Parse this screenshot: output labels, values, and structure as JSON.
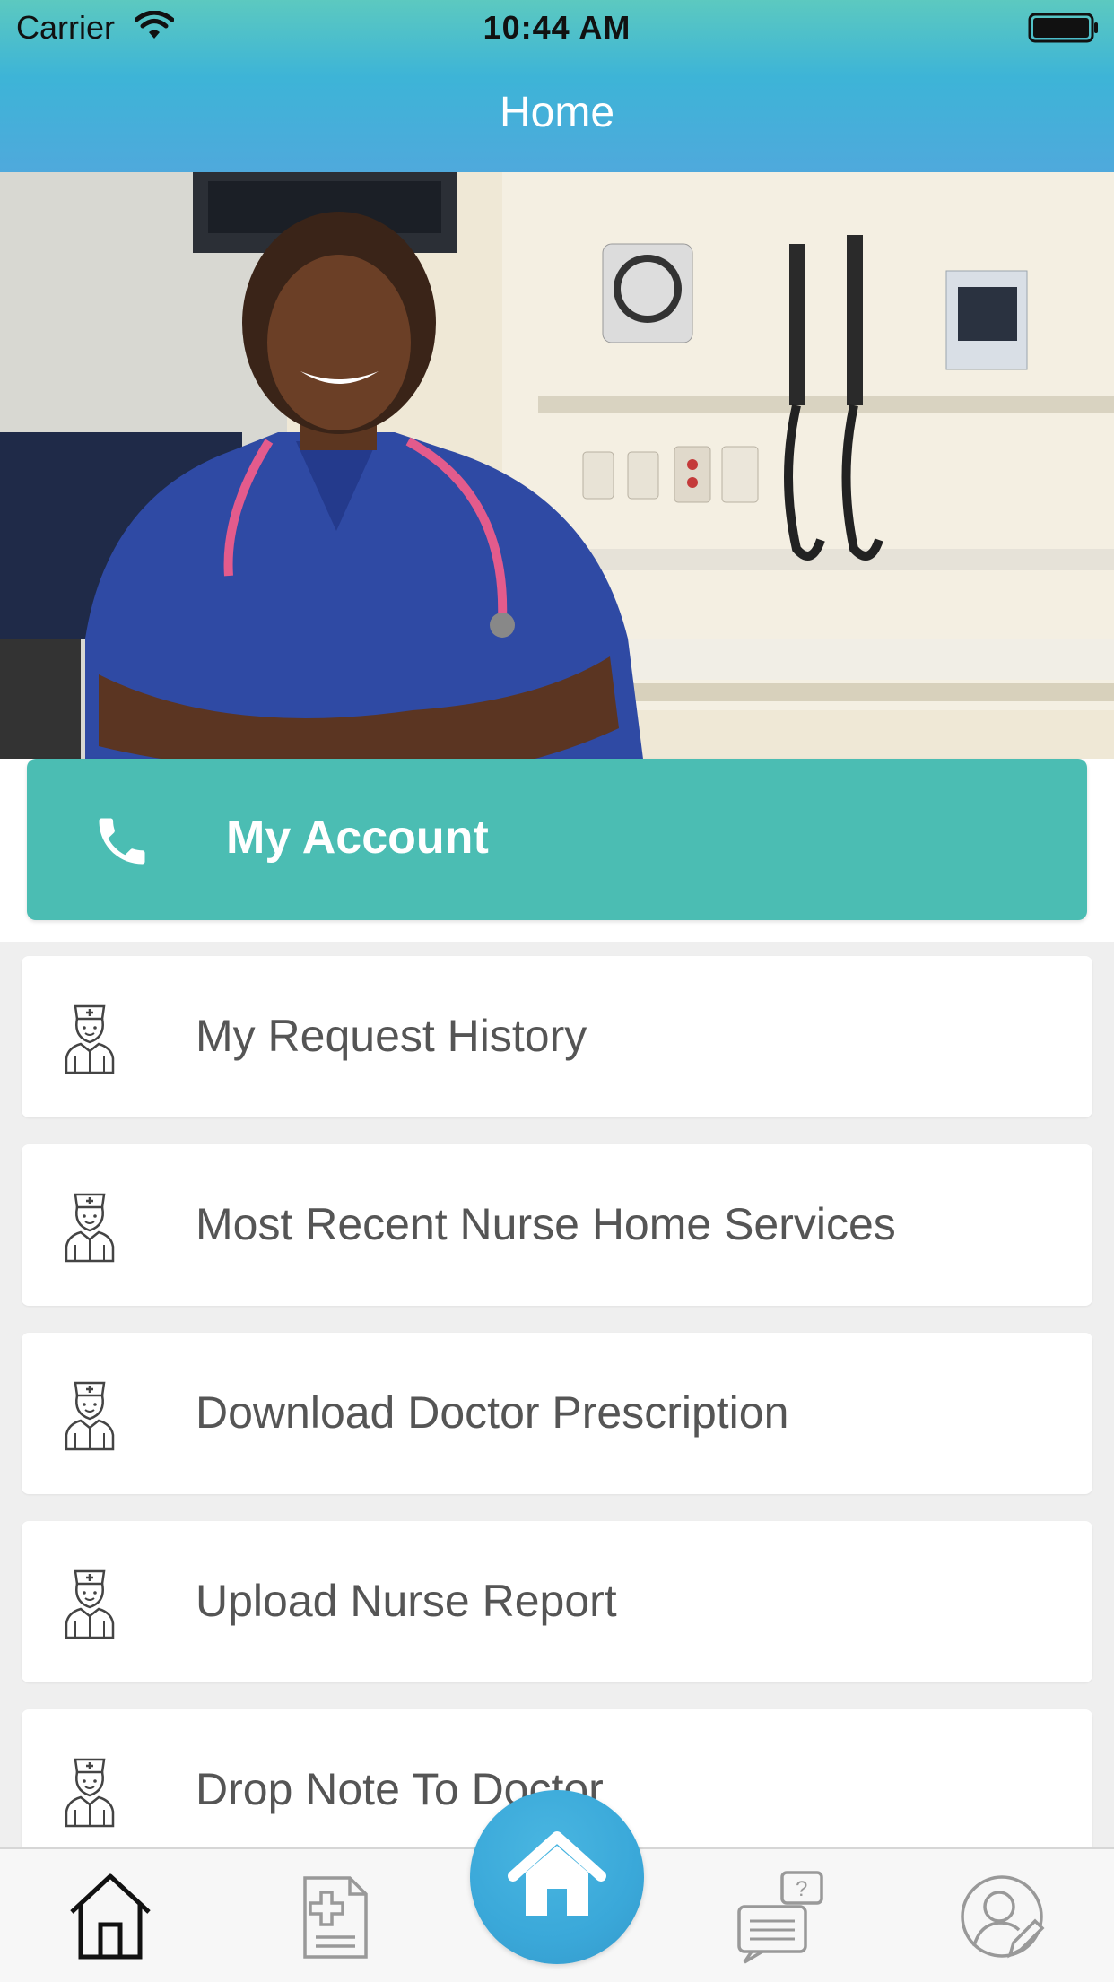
{
  "status_bar": {
    "carrier": "Carrier",
    "time": "10:44 AM"
  },
  "header": {
    "title": "Home"
  },
  "hero": {
    "icon": "nurse-photo"
  },
  "account_button": {
    "label": "My Account",
    "icon": "phone-icon",
    "color": "#4bbdb3"
  },
  "menu": [
    {
      "label": "My Request History",
      "icon": "nurse-icon"
    },
    {
      "label": "Most Recent Nurse Home Services",
      "icon": "nurse-icon"
    },
    {
      "label": "Download Doctor Prescription",
      "icon": "nurse-icon"
    },
    {
      "label": "Upload Nurse Report",
      "icon": "nurse-icon"
    },
    {
      "label": "Drop Note To Doctor",
      "icon": "nurse-icon"
    }
  ],
  "tab_bar": {
    "items": [
      "home-icon",
      "prescription-icon",
      "center-home-icon",
      "chat-question-icon",
      "profile-edit-icon"
    ],
    "accent": "#3aa8d9"
  }
}
